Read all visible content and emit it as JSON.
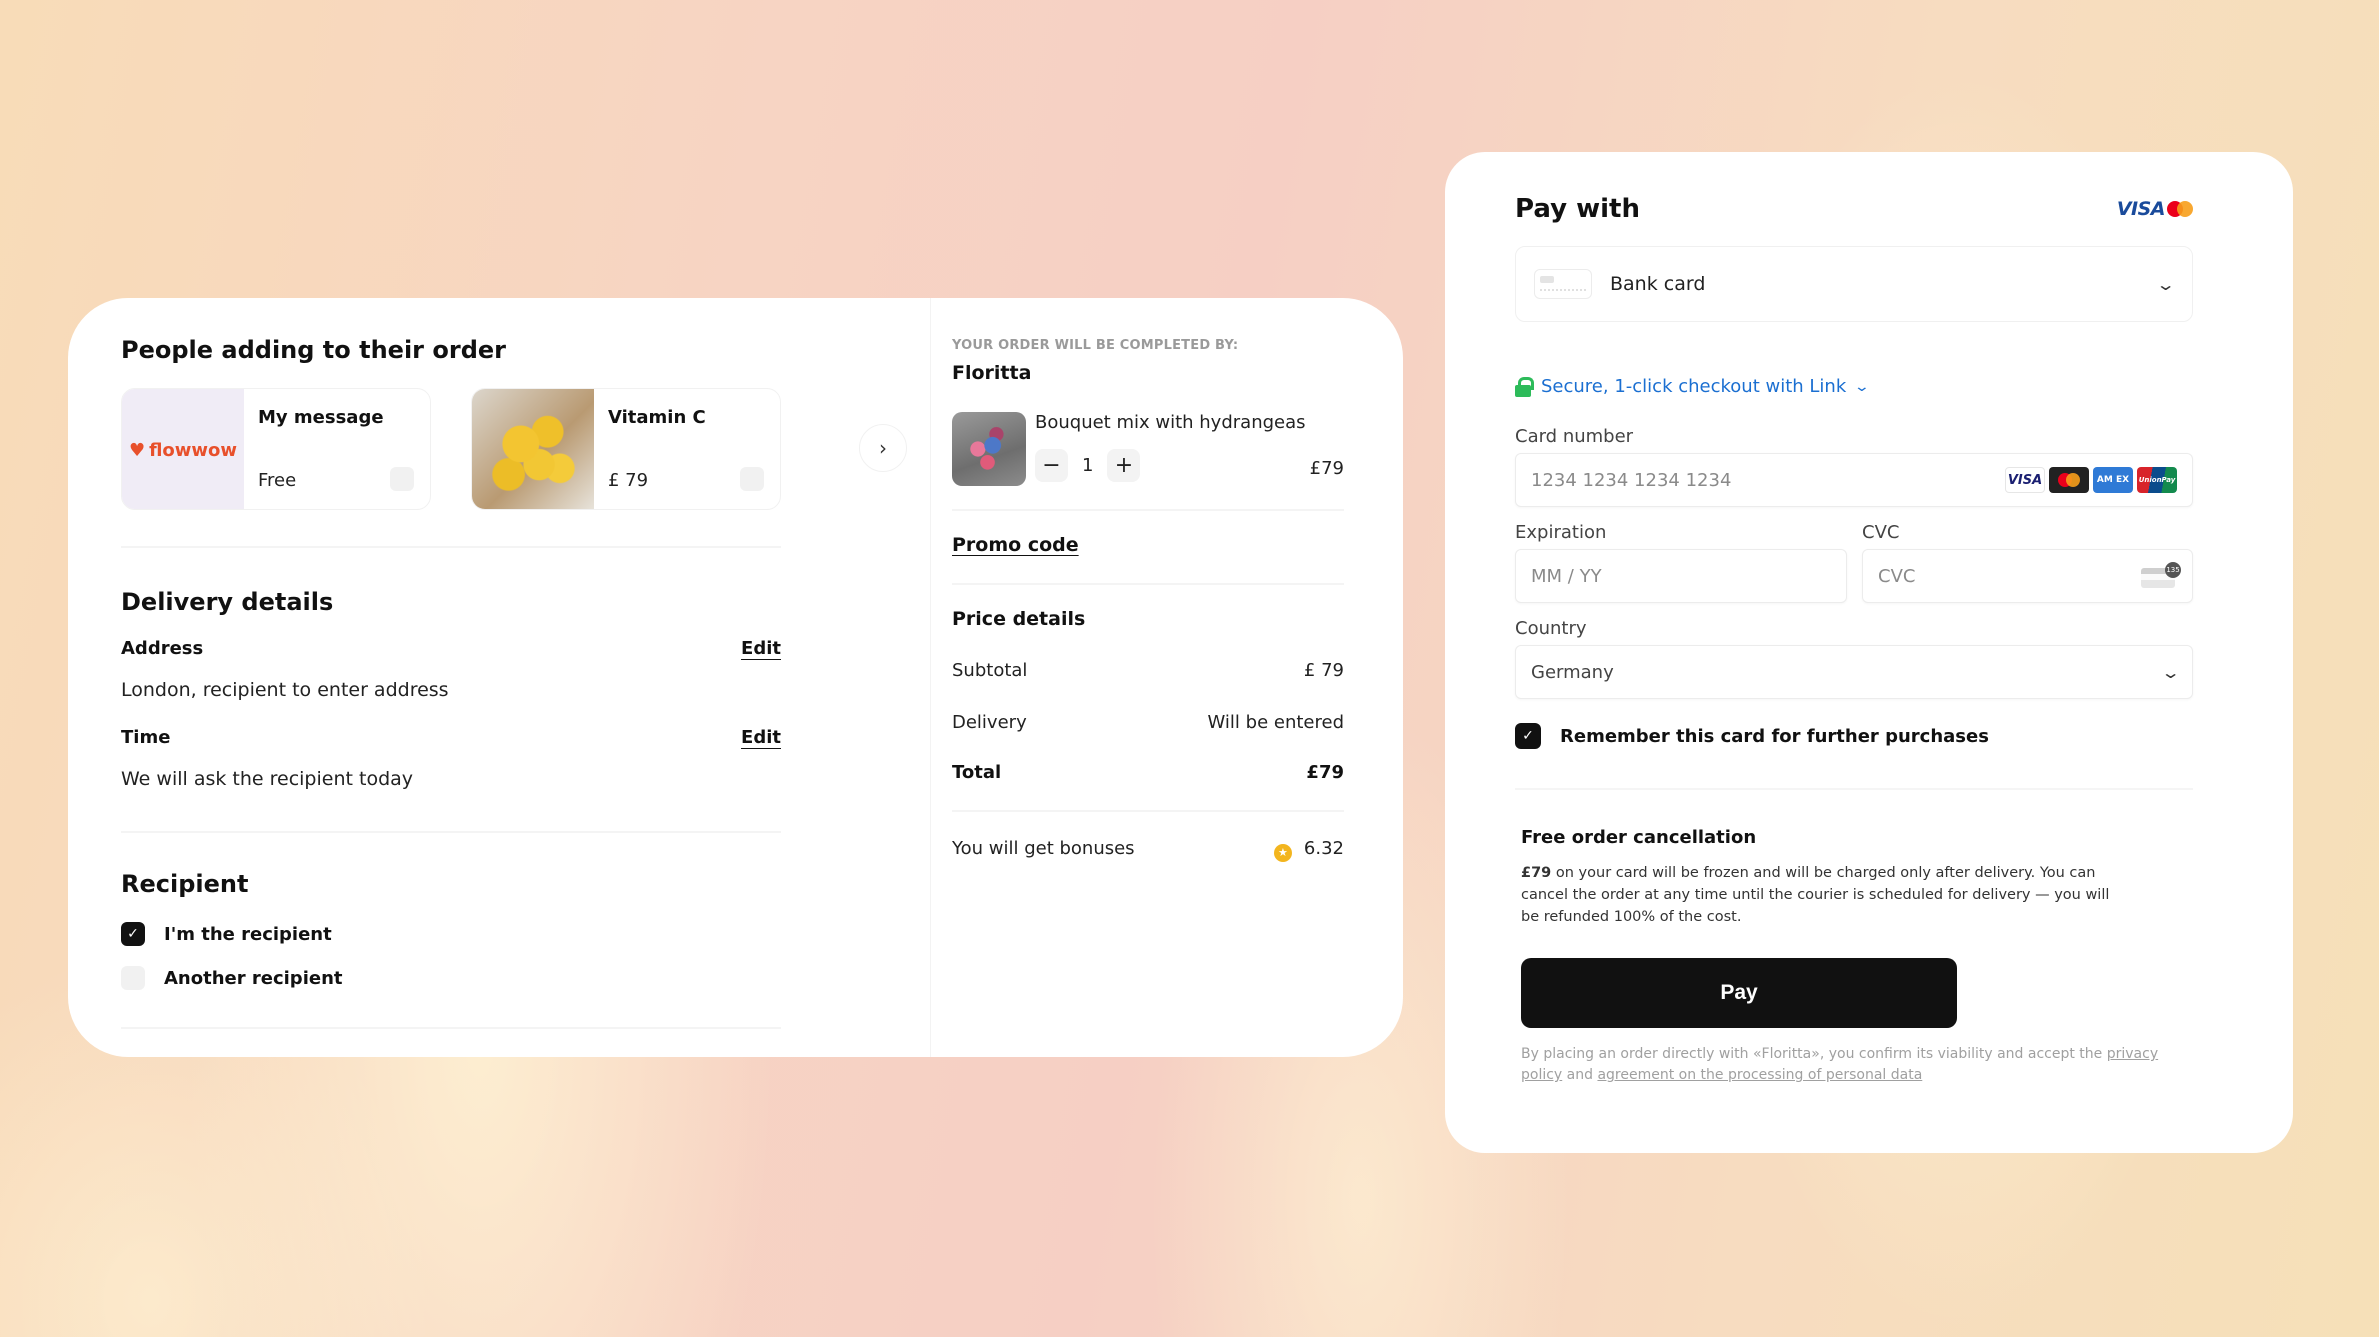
{
  "addons": {
    "title": "People adding to their order",
    "items": [
      {
        "name": "My message",
        "price": "Free",
        "thumb": "flowwow-logo",
        "logo_text": "flowwow",
        "checked": false
      },
      {
        "name": "Vitamin C",
        "price": "£ 79",
        "thumb": "lemon-bouquet-photo",
        "checked": false
      }
    ],
    "next_icon": "›"
  },
  "delivery": {
    "title": "Delivery details",
    "address_label": "Address",
    "address_value": "London, recipient to enter address",
    "time_label": "Time",
    "time_value": "We will ask the recipient today",
    "edit_label": "Edit"
  },
  "recipient": {
    "title": "Recipient",
    "options": [
      {
        "label": "I'm the recipient",
        "checked": true
      },
      {
        "label": "Another recipient",
        "checked": false
      }
    ]
  },
  "order": {
    "completed_by_label": "YOUR ORDER WILL BE COMPLETED BY:",
    "seller": "Floritta",
    "item": {
      "name": "Bouquet mix with hydrangeas",
      "quantity": "1",
      "price": "£79",
      "minus": "−",
      "plus": "+"
    },
    "promo_label": "Promo code",
    "price_details_title": "Price details",
    "subtotal_label": "Subtotal",
    "subtotal_value": "£ 79",
    "delivery_label": "Delivery",
    "delivery_value": "Will be entered",
    "total_label": "Total",
    "total_value": "£79",
    "bonus_label": "You will get bonuses",
    "bonus_value": "6.32",
    "bonus_icon": "★"
  },
  "payment": {
    "title": "Pay with",
    "header_brands": {
      "visa": "VISA"
    },
    "method": "Bank card",
    "link_text": "Secure, 1-click checkout with Link",
    "card_number_label": "Card number",
    "card_number_placeholder": "1234 1234 1234 1234",
    "card_brands": {
      "visa": "VISA",
      "amex": "AM EX",
      "unionpay": "UnionPay"
    },
    "expiration_label": "Expiration",
    "expiration_placeholder": "MM / YY",
    "cvc_label": "CVC",
    "cvc_placeholder": "CVC",
    "cvc_badge": "135",
    "country_label": "Country",
    "country_value": "Germany",
    "remember_label": "Remember this card for further purchases",
    "remember_checked": true,
    "cancel_title": "Free order cancellation",
    "cancel_amount": "£79",
    "cancel_text": " on your card will be frozen and will be charged only after delivery. You can cancel the order at any time until the courier is scheduled for delivery — you will be refunded 100% of the cost.",
    "pay_label": "Pay",
    "legal_text": "By placing an order directly with «Floritta», you confirm its viability and accept the ",
    "privacy_link": "privacy policy",
    "legal_and": " and ",
    "agreement_link": "agreement on the processing of personal data"
  },
  "colors": {
    "accent_link": "#1b6fd1",
    "lock_green": "#2dbb5a",
    "brand_red": "#e8502b",
    "button_dark": "#111111",
    "bonus_coin": "#f3b51e"
  }
}
